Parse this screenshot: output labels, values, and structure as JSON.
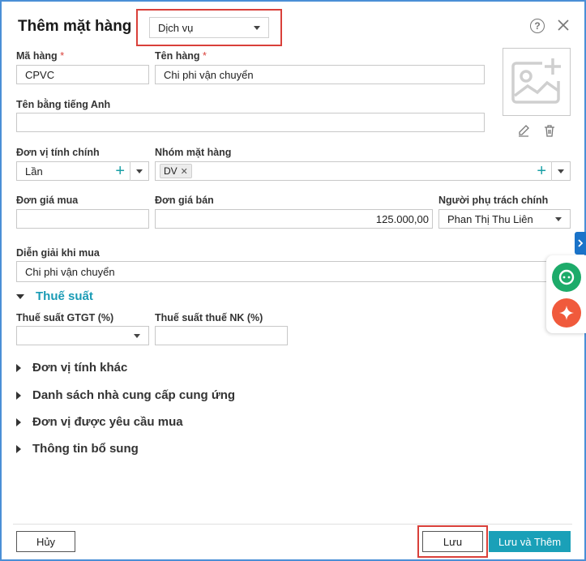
{
  "dialog": {
    "title": "Thêm mặt hàng",
    "type_select": "Dịch vụ"
  },
  "fields": {
    "code_label": "Mã hàng",
    "code_value": "CPVC",
    "name_label": "Tên hàng",
    "name_value": "Chi phi vận chuyển",
    "english_name_label": "Tên bằng tiếng Anh",
    "english_name_value": "",
    "unit_label": "Đơn vị tính chính",
    "unit_value": "Lần",
    "group_label": "Nhóm mặt hàng",
    "group_tag": "DV",
    "purchase_price_label": "Đơn giá mua",
    "purchase_price_value": "",
    "sale_price_label": "Đơn giá bán",
    "sale_price_value": "125.000,00",
    "responsible_label": "Người phụ trách chính",
    "responsible_value": "Phan Thị Thu Liên",
    "purchase_desc_label": "Diễn giải khi mua",
    "purchase_desc_value": "Chi phi vận chuyển"
  },
  "tax": {
    "section_title": "Thuế suất",
    "vat_label": "Thuế suất GTGT (%)",
    "vat_value": "",
    "import_label": "Thuế suất thuế NK (%)",
    "import_value": ""
  },
  "sections": [
    {
      "title": "Đơn vị tính khác"
    },
    {
      "title": "Danh sách nhà cung cấp cung ứng"
    },
    {
      "title": "Đơn vị được yêu cầu mua"
    },
    {
      "title": "Thông tin bổ sung"
    }
  ],
  "footer": {
    "cancel_label": "Hủy",
    "save_label": "Lưu",
    "save_add_label": "Lưu và Thêm"
  },
  "colors": {
    "accent": "#1aa0b8",
    "highlight": "#d9403a",
    "chat": "#1dab6a",
    "ai": "#f05a3c",
    "frame": "#4a8fd6"
  }
}
